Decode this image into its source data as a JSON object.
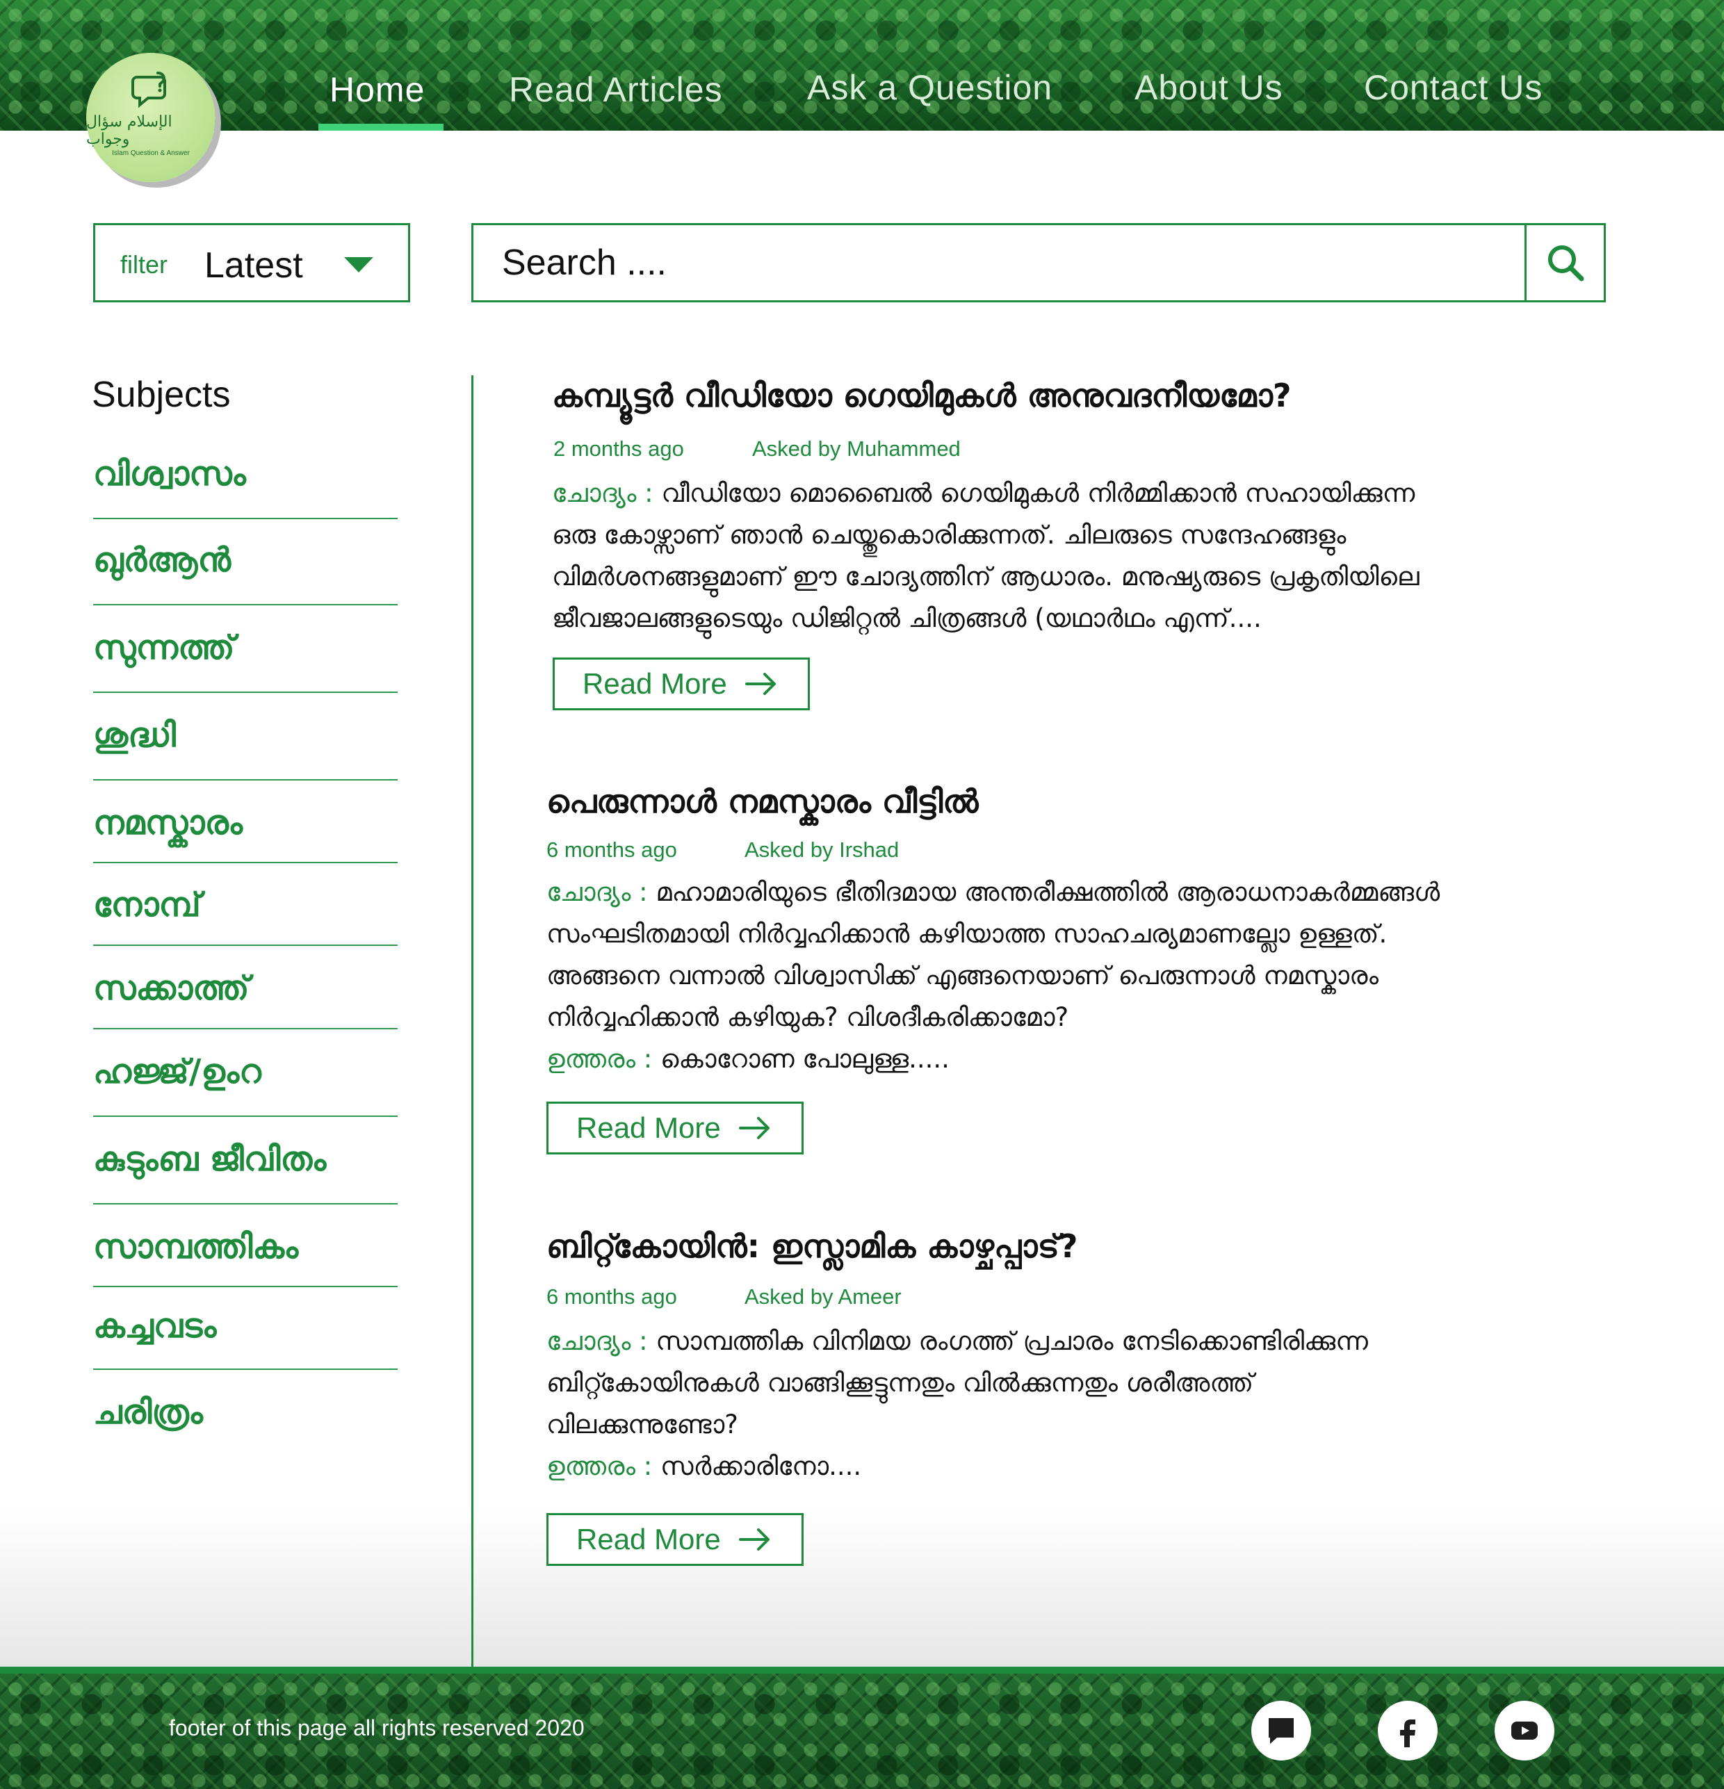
{
  "header": {
    "logo": {
      "caption": "Islam Question & Answer",
      "arabic": "الإسلام سؤال وجواب"
    },
    "nav": [
      {
        "label": "Home",
        "active": true
      },
      {
        "label": "Read Articles",
        "active": false
      },
      {
        "label": "Ask a Question",
        "active": false
      },
      {
        "label": "About Us",
        "active": false
      },
      {
        "label": "Contact Us",
        "active": false
      }
    ]
  },
  "filter": {
    "label": "filter",
    "value": "Latest"
  },
  "search": {
    "placeholder": "Search ...."
  },
  "sidebar": {
    "title": "Subjects",
    "items": [
      "വിശ്വാസം",
      "ഖുർആൻ",
      "സുന്നത്ത്",
      "ശുദ്ധി",
      "നമസ്കാരം",
      "നോമ്പ്",
      "സക്കാത്ത്",
      "ഹജ്ജ്/ഉംറ",
      "കുടുംബ ജീവിതം",
      "സാമ്പത്തികം",
      "കച്ചവടം",
      "ചരിത്രം"
    ]
  },
  "articles": [
    {
      "title": "കമ്പ്യൂട്ടർ വീഡിയോ ഗെയിമുകൾ അനുവദനീയമോ?",
      "time": "2 months ago",
      "asked_by": "Asked by Muhammed",
      "question_label": "ചോദ്യം :",
      "question_lines": [
        " വീഡിയോ മൊബൈൽ ഗെയിമുകൾ നിർമ്മിക്കാൻ സഹായിക്കുന്ന",
        "ഒരു കോഴ്സാണ് ഞാൻ ചെയ്തുകൊരിക്കുന്നത്. ചിലരുടെ സന്ദേഹങ്ങളും",
        "വിമർശനങ്ങളുമാണ് ഈ ചോദ്യത്തിന് ആധാരം. മനുഷ്യരുടെ പ്രകൃതിയിലെ",
        "ജീവജാലങ്ങളുടെയും ഡിജിറ്റൽ ചിത്രങ്ങൾ (യഥാർഥം എന്ന്...."
      ],
      "answer_label": "",
      "answer_text": "",
      "read_more": "Read More"
    },
    {
      "title": "പെരുന്നാൾ നമസ്കാരം വീട്ടിൽ",
      "time": "6 months ago",
      "asked_by": "Asked by Irshad",
      "question_label": "ചോദ്യം :",
      "question_lines": [
        " മഹാമാരിയുടെ ഭീതിദമായ അന്തരീക്ഷത്തിൽ ആരാധനാകർമ്മങ്ങൾ",
        "സംഘടിതമായി നിർവ്വഹിക്കാൻ കഴിയാത്ത സാഹചര്യമാണല്ലോ ഉള്ളത്.",
        "അങ്ങനെ വന്നാൽ വിശ്വാസിക്ക് എങ്ങനെയാണ് പെരുന്നാൾ നമസ്കാരം",
        "നിർവ്വഹിക്കാൻ കഴിയുക? വിശദീകരിക്കാമോ?"
      ],
      "answer_label": "ഉത്തരം :",
      "answer_text": " കൊറോണ പോലുള്ള.....",
      "read_more": "Read More"
    },
    {
      "title": "ബിറ്റ്കോയിൻ: ഇസ്ലാമിക കാഴ്ചപ്പാട്?",
      "time": "6 months ago",
      "asked_by": "Asked by Ameer",
      "question_label": "ചോദ്യം :",
      "question_lines": [
        " സാമ്പത്തിക വിനിമയ രംഗത്ത് പ്രചാരം നേടിക്കൊണ്ടിരിക്കുന്ന",
        "ബിറ്റ്കോയിനുകൾ വാങ്ങിക്കൂട്ടുന്നതും വിൽക്കുന്നതും ശരീഅത്ത്",
        "വിലക്കുന്നുണ്ടോ?"
      ],
      "answer_label": "ഉത്തരം :",
      "answer_text": " സർക്കാരിനോ....",
      "read_more": "Read More"
    }
  ],
  "footer": {
    "text": "footer of this page all rights reserved 2020",
    "social": [
      "chat-icon",
      "facebook-icon",
      "youtube-icon"
    ]
  },
  "colors": {
    "brand_green": "#1e8a3c",
    "nav_active": "#3fd07a",
    "header_green": "#1f6e2c"
  }
}
